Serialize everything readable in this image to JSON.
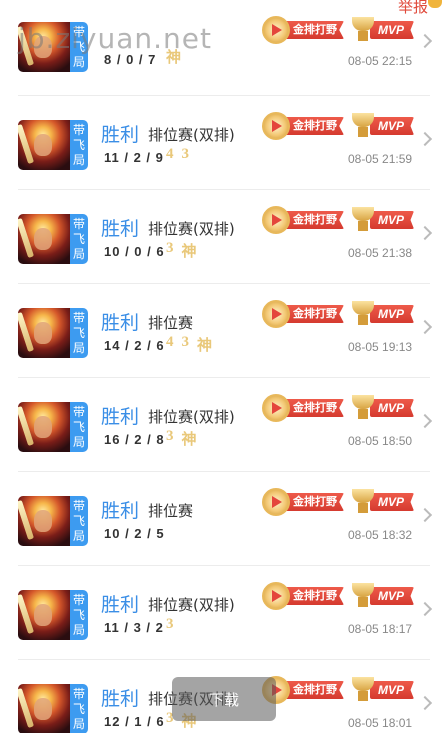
{
  "watermark": "jb.ziyuan.net",
  "report_label": "举报",
  "toast_label": "下载",
  "matches": [
    {
      "tag": [
        "带",
        "飞",
        "局"
      ],
      "result": "",
      "mode": "",
      "kda": "8 / 0 / 7",
      "badges": [
        "神"
      ],
      "medal1": "金排打野",
      "medal2": "MVP",
      "time": "08-05 22:15"
    },
    {
      "tag": [
        "带",
        "飞",
        "局"
      ],
      "result": "胜利",
      "mode": "排位赛(双排)",
      "kda": "11 / 2 / 9",
      "badges": [
        "4",
        "3"
      ],
      "medal1": "金排打野",
      "medal2": "MVP",
      "time": "08-05 21:59"
    },
    {
      "tag": [
        "带",
        "飞",
        "局"
      ],
      "result": "胜利",
      "mode": "排位赛(双排)",
      "kda": "10 / 0 / 6",
      "badges": [
        "3",
        "神"
      ],
      "medal1": "金排打野",
      "medal2": "MVP",
      "time": "08-05 21:38"
    },
    {
      "tag": [
        "带",
        "飞",
        "局"
      ],
      "result": "胜利",
      "mode": "排位赛",
      "kda": "14 / 2 / 6",
      "badges": [
        "4",
        "3",
        "神"
      ],
      "medal1": "金排打野",
      "medal2": "MVP",
      "time": "08-05 19:13"
    },
    {
      "tag": [
        "带",
        "飞",
        "局"
      ],
      "result": "胜利",
      "mode": "排位赛(双排)",
      "kda": "16 / 2 / 8",
      "badges": [
        "3",
        "神"
      ],
      "medal1": "金排打野",
      "medal2": "MVP",
      "time": "08-05 18:50"
    },
    {
      "tag": [
        "带",
        "飞",
        "局"
      ],
      "result": "胜利",
      "mode": "排位赛",
      "kda": "10 / 2 / 5",
      "badges": [],
      "medal1": "金排打野",
      "medal2": "MVP",
      "time": "08-05 18:32"
    },
    {
      "tag": [
        "带",
        "飞",
        "局"
      ],
      "result": "胜利",
      "mode": "排位赛(双排)",
      "kda": "11 / 3 / 2",
      "badges": [
        "3"
      ],
      "medal1": "金排打野",
      "medal2": "MVP",
      "time": "08-05 18:17"
    },
    {
      "tag": [
        "带",
        "飞",
        "局"
      ],
      "result": "胜利",
      "mode": "排位赛(双排)",
      "kda": "12 / 1 / 6",
      "badges": [
        "3",
        "神"
      ],
      "medal1": "金排打野",
      "medal2": "MVP",
      "time": "08-05 18:01"
    }
  ]
}
